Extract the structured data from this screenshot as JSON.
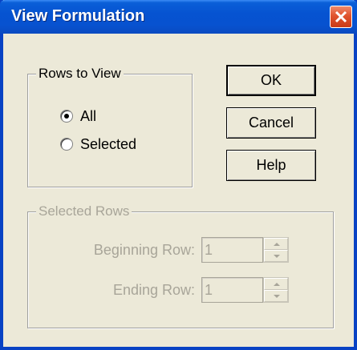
{
  "window": {
    "title": "View Formulation",
    "title_color": "#0653d1"
  },
  "rows_to_view": {
    "legend": "Rows to View",
    "options": [
      {
        "label": "All",
        "selected": true
      },
      {
        "label": "Selected",
        "selected": false
      }
    ]
  },
  "buttons": {
    "ok": "OK",
    "cancel": "Cancel",
    "help": "Help"
  },
  "selected_rows": {
    "legend": "Selected Rows",
    "enabled": false,
    "beginning": {
      "label": "Beginning Row:",
      "value": "1"
    },
    "ending": {
      "label": "Ending Row:",
      "value": "1"
    }
  },
  "icons": {
    "close": "close-icon",
    "spin_up": "chevron-up-icon",
    "spin_down": "chevron-down-icon"
  }
}
